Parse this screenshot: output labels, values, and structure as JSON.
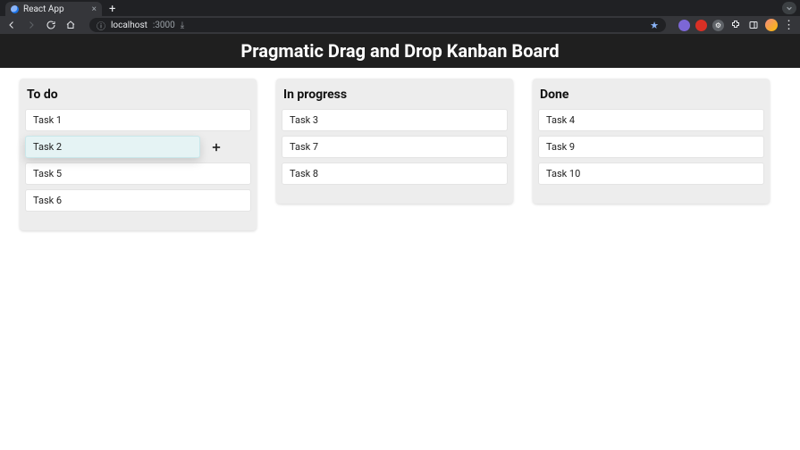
{
  "browser": {
    "tab_title": "React App",
    "url_host": "localhost",
    "url_port": ":3000"
  },
  "page": {
    "title": "Pragmatic Drag and Drop Kanban Board"
  },
  "columns": [
    {
      "title": "To do",
      "cards": [
        {
          "label": "Task 1",
          "dragging": false
        },
        {
          "label": "Task 2",
          "dragging": true
        },
        {
          "label": "Task 5",
          "dragging": false
        },
        {
          "label": "Task 6",
          "dragging": false
        }
      ]
    },
    {
      "title": "In progress",
      "cards": [
        {
          "label": "Task 3",
          "dragging": false
        },
        {
          "label": "Task 7",
          "dragging": false
        },
        {
          "label": "Task 8",
          "dragging": false
        }
      ]
    },
    {
      "title": "Done",
      "cards": [
        {
          "label": "Task 4",
          "dragging": false
        },
        {
          "label": "Task 9",
          "dragging": false
        },
        {
          "label": "Task 10",
          "dragging": false
        }
      ]
    }
  ]
}
